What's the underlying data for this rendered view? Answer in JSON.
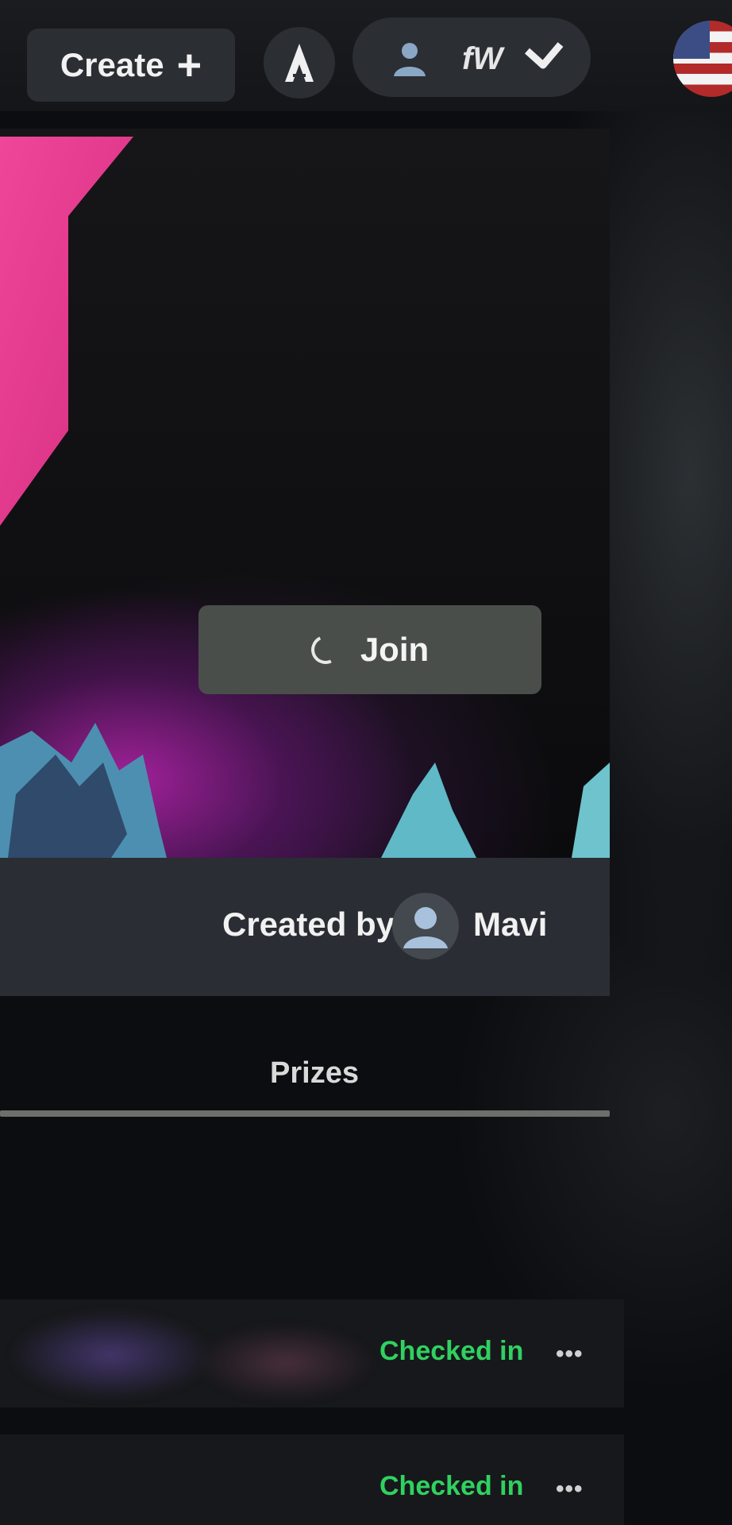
{
  "header": {
    "create_label": "Create",
    "create_icon": "plus-icon",
    "logo_icon": "app-logo-icon",
    "account_initials": "fW",
    "account_icon": "user-icon",
    "account_chevron_icon": "chevron-down-icon",
    "language_icon": "us-flag-icon"
  },
  "event": {
    "join_label": "Join",
    "join_state_icon": "spinner-icon",
    "created_by_label": "Created by",
    "creator_name": "Mavi",
    "creator_avatar_icon": "user-avatar-icon",
    "accent_color": "#e43b8a"
  },
  "tabs": {
    "prizes_label": "Prizes"
  },
  "participants": [
    {
      "status": "Checked in",
      "status_color": "#30d160",
      "menu_label": "•••"
    },
    {
      "status": "Checked in",
      "status_color": "#30d160",
      "menu_label": "•••"
    }
  ]
}
